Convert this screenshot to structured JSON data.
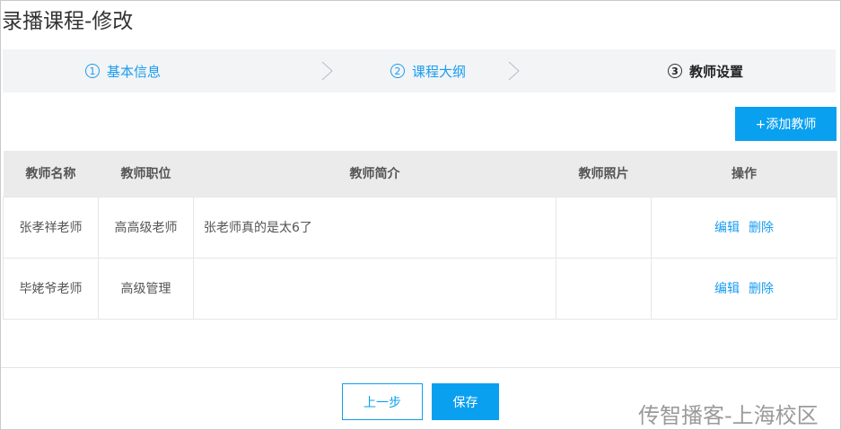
{
  "page": {
    "title": "录播课程-修改"
  },
  "steps": [
    {
      "num": "1",
      "label": "基本信息",
      "state": "done"
    },
    {
      "num": "2",
      "label": "课程大纲",
      "state": "done"
    },
    {
      "num": "3",
      "label": "教师设置",
      "state": "active"
    }
  ],
  "toolbar": {
    "add_teacher_label": "+添加教师"
  },
  "table": {
    "headers": [
      "教师名称",
      "教师职位",
      "教师简介",
      "教师照片",
      "操作"
    ],
    "rows": [
      {
        "name": "张孝祥老师",
        "position": "高高级老师",
        "intro": "张老师真的是太6了",
        "photo": "",
        "edit": "编辑",
        "delete": "删除"
      },
      {
        "name": "毕姥爷老师",
        "position": "高级管理",
        "intro": "",
        "photo": "",
        "edit": "编辑",
        "delete": "删除"
      }
    ]
  },
  "footer": {
    "prev_label": "上一步",
    "save_label": "保存"
  },
  "watermark": "传智播客-上海校区",
  "colors": {
    "accent": "#0aa0f0",
    "step_bar": "#f2f4f6",
    "header_bg": "#ebebeb"
  }
}
